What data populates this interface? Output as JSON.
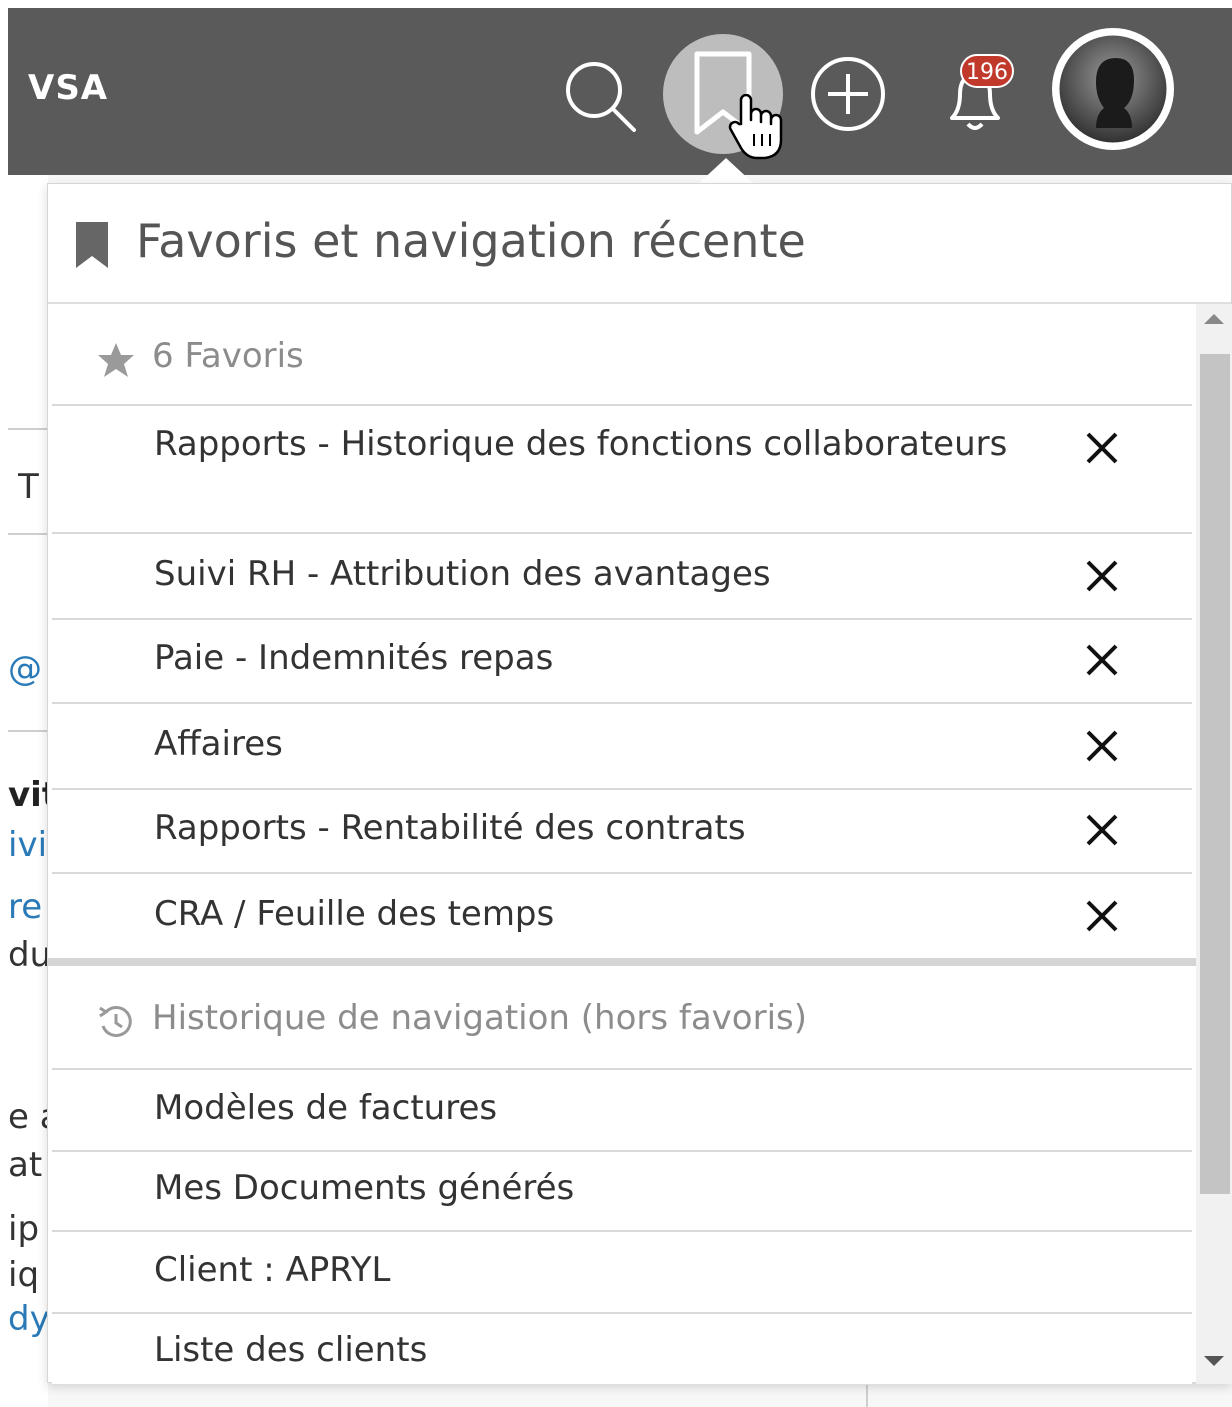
{
  "topbar": {
    "brand": "VSA",
    "notifications_count": "196"
  },
  "background_fragments": [
    "T",
    "@",
    "vit",
    "ivi",
    "re",
    "du",
    "e a",
    "at",
    "ip",
    "iq",
    "dy"
  ],
  "panel": {
    "title": "Favoris et navigation récente",
    "favorites_header": "6 Favoris",
    "favorites": [
      {
        "label": "Rapports - Historique des fonctions collaborateurs"
      },
      {
        "label": "Suivi RH - Attribution des avantages"
      },
      {
        "label": "Paie - Indemnités repas"
      },
      {
        "label": "Affaires"
      },
      {
        "label": "Rapports - Rentabilité des contrats"
      },
      {
        "label": "CRA / Feuille des temps"
      }
    ],
    "history_header": "Historique de navigation (hors favoris)",
    "history": [
      {
        "label": "Modèles de factures"
      },
      {
        "label": "Mes Documents générés"
      },
      {
        "label": "Client : APRYL"
      },
      {
        "label": "Liste des clients"
      }
    ]
  },
  "colors": {
    "topbar": "#5a5a5a",
    "badge": "#c0392b",
    "link_blue": "#2a7ab8"
  }
}
